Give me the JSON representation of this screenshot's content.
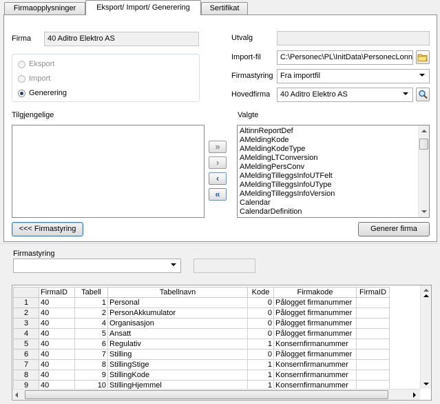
{
  "tabs": [
    "Firmaopplysninger",
    "Eksport/ Import/ Generering",
    "Sertifikat"
  ],
  "firma": {
    "label": "Firma",
    "value": "40 Aditro Elektro AS"
  },
  "mode": {
    "options": [
      "Eksport",
      "Import",
      "Generering"
    ],
    "selected": "Generering"
  },
  "utvalg": {
    "label": "Utvalg",
    "value": ""
  },
  "importfil": {
    "label": "Import-fil",
    "value": "C:\\Personec\\PL\\InitData\\PersonecLonn"
  },
  "firmastyring": {
    "label": "Firmastyring",
    "value": "Fra importfil"
  },
  "hovedfirma": {
    "label": "Hovedfirma",
    "value": "40 Aditro Elektro AS"
  },
  "lists": {
    "available_label": "Tilgjengelige",
    "selected_label": "Valgte",
    "selected_items": [
      "AltinnReportDef",
      "AMeldingKode",
      "AMeldingKodeType",
      "AMeldingLTConversion",
      "AMeldingPersConv",
      "AMeldingTilleggsInfoUTFelt",
      "AMeldingTilleggsInfoUType",
      "AMeldingTilleggsInfoVersion",
      "Calendar",
      "CalendarDefinition"
    ]
  },
  "move_buttons": [
    "»",
    "›",
    "‹",
    "«"
  ],
  "buttons": {
    "firmastyring": "<<< Firmastyring",
    "generer": "Generer firma"
  },
  "lower": {
    "label": "Firmastyring",
    "combo_value": "",
    "field_value": ""
  },
  "grid": {
    "columns": [
      "FirmaID",
      "Tabell",
      "Tabellnavn",
      "Kode",
      "Firmakode",
      "FirmaID"
    ],
    "rows": [
      [
        "1",
        "40",
        "1",
        "Personal",
        "0",
        "Pålogget firmanummer",
        ""
      ],
      [
        "2",
        "40",
        "2",
        "PersonAkkumulator",
        "0",
        "Pålogget firmanummer",
        ""
      ],
      [
        "3",
        "40",
        "4",
        "Organisasjon",
        "0",
        "Pålogget firmanummer",
        ""
      ],
      [
        "4",
        "40",
        "5",
        "Ansatt",
        "0",
        "Pålogget firmanummer",
        ""
      ],
      [
        "5",
        "40",
        "6",
        "Regulativ",
        "1",
        "Konsernfirmanummer",
        ""
      ],
      [
        "6",
        "40",
        "7",
        "Stilling",
        "0",
        "Pålogget firmanummer",
        ""
      ],
      [
        "7",
        "40",
        "8",
        "StillingStige",
        "1",
        "Konsernfirmanummer",
        ""
      ],
      [
        "8",
        "40",
        "9",
        "StillingKode",
        "1",
        "Konsernfirmanummer",
        ""
      ],
      [
        "9",
        "40",
        "10",
        "StillingHjemmel",
        "1",
        "Konsernfirmanummer",
        ""
      ]
    ]
  }
}
